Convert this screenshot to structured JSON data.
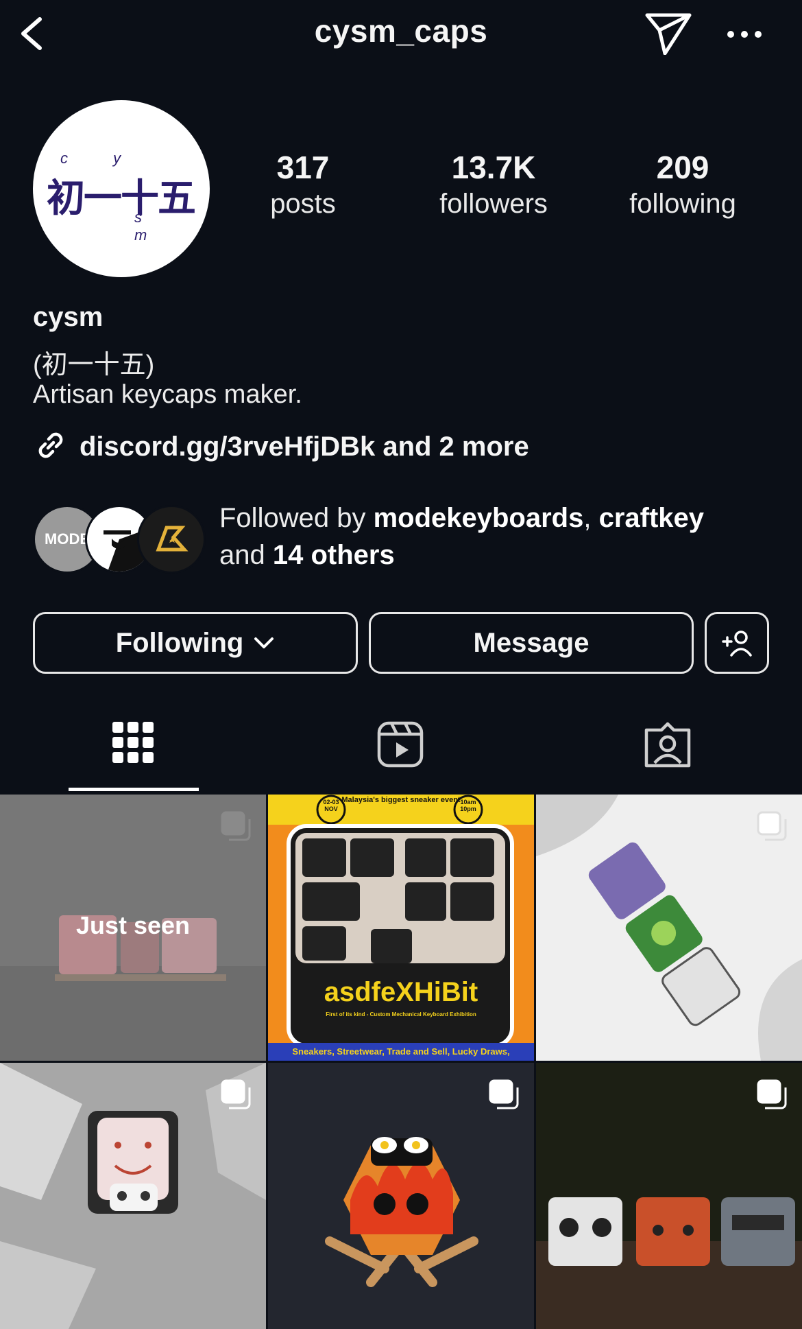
{
  "header": {
    "username": "cysm_caps"
  },
  "avatar": {
    "top_letters": "c y",
    "kanji": "初一十五",
    "bottom_letters": "s m"
  },
  "stats": [
    {
      "value": "317",
      "label": "posts"
    },
    {
      "value": "13.7K",
      "label": "followers"
    },
    {
      "value": "209",
      "label": "following"
    }
  ],
  "bio": {
    "name": "cysm",
    "line1": "(初一十五)",
    "line2": "Artisan keycaps maker.",
    "link": "discord.gg/3rveHfjDBk and 2 more"
  },
  "followed_by": {
    "prefix": "Followed by ",
    "user1": "modekeyboards",
    "sep": ", ",
    "user2": "craftkey",
    "mid": " and ",
    "others": "14 others",
    "avatar1_text": "MODE"
  },
  "buttons": {
    "following": "Following",
    "message": "Message"
  },
  "tabs": [
    "posts-grid",
    "reels",
    "tagged"
  ],
  "grid": {
    "overlay_text": "Just seen",
    "event_banner_top": "Malaysia's biggest sneaker event",
    "event_date": "02-03 NOV",
    "event_time": "10am 10pm",
    "event_title": "asdfeXHiBit",
    "event_sub": "First of its kind - Custom Mechanical Keyboard Exhibition",
    "event_footer": "Sneakers, Streetwear, Trade and Sell, Lucky Draws,"
  },
  "colors": {
    "background": "#0b0f17",
    "text": "#f5f5f5",
    "avatar_ink": "#2a1d6d",
    "event_orange": "#f28c1c",
    "event_yellow": "#f5d21c"
  }
}
